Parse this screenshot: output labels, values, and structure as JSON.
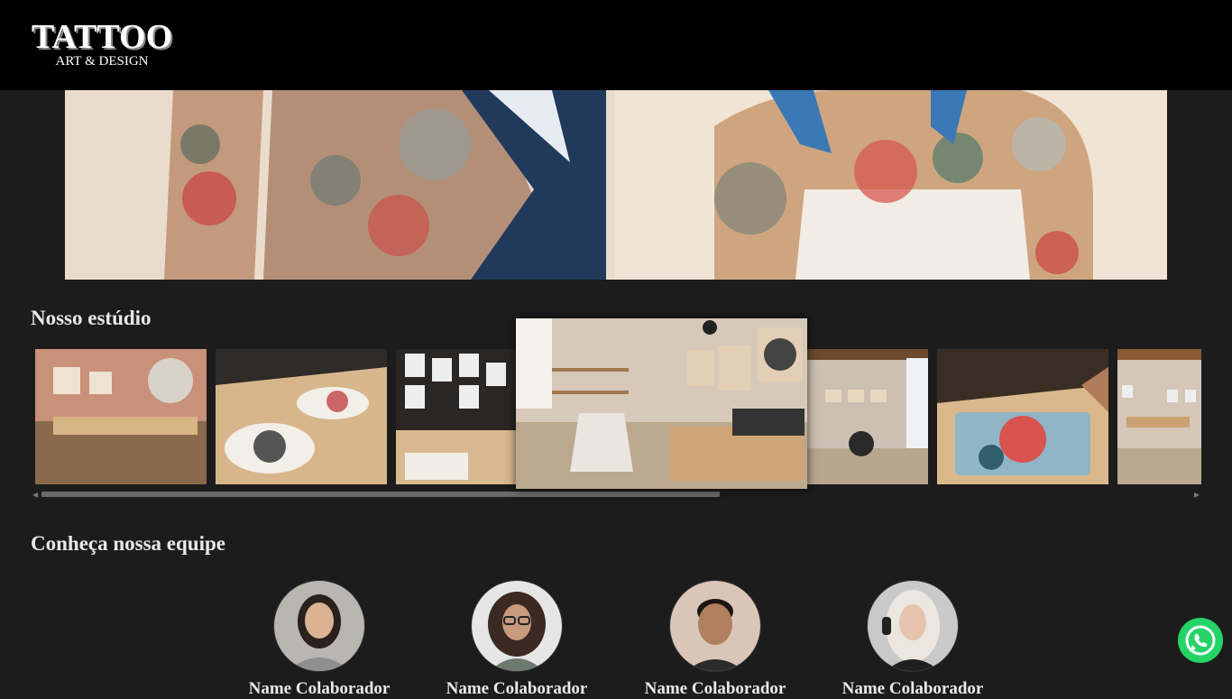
{
  "header": {
    "logo_title": "TATTOO",
    "logo_subtitle": "ART & DESIGN"
  },
  "hero": {
    "image": "tattooed-arms-and-chest-photo"
  },
  "studio": {
    "title": "Nosso estúdio",
    "photos": [
      "studio-desk",
      "tattoo-sketches",
      "flash-wall",
      "studio-chairs",
      "studio-room",
      "drawing-rose",
      "studio-corner"
    ]
  },
  "team": {
    "title": "Conheça nossa equipe",
    "members": [
      {
        "name": "Name Colaborador",
        "avatar": "woman-straight-hair"
      },
      {
        "name": "Name Colaborador",
        "avatar": "woman-curly-hair-glasses"
      },
      {
        "name": "Name Colaborador",
        "avatar": "man-short-hair"
      },
      {
        "name": "Name Colaborador",
        "avatar": "woman-blonde-headphones"
      }
    ]
  },
  "floating": {
    "whatsapp_icon": "whatsapp-icon"
  },
  "colors": {
    "header_bg": "#000000",
    "page_bg": "#1c1c1c",
    "whatsapp": "#25d366"
  }
}
